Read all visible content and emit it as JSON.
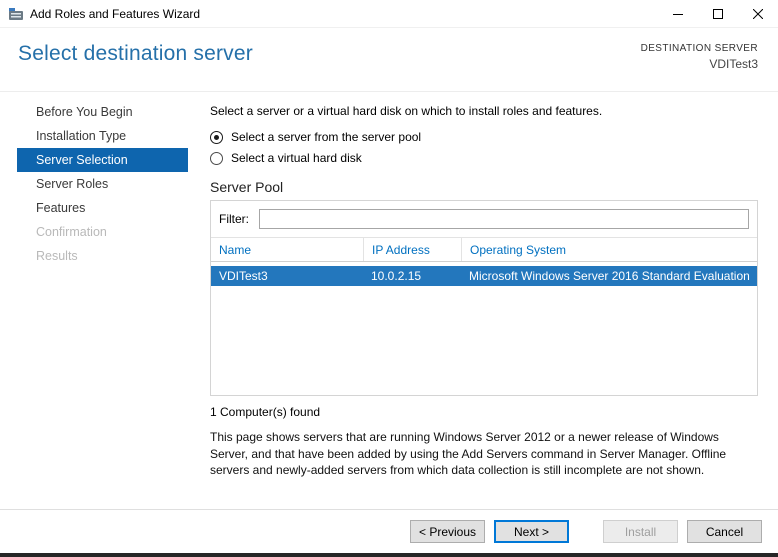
{
  "window": {
    "title": "Add Roles and Features Wizard",
    "icons": {
      "app": "server-manager-icon",
      "minimize": "minimize-icon",
      "maximize": "maximize-icon",
      "close": "close-icon"
    }
  },
  "header": {
    "title": "Select destination server",
    "destination_label": "DESTINATION SERVER",
    "destination_value": "VDITest3"
  },
  "sidebar": {
    "items": [
      {
        "label": "Before You Begin",
        "state": "enabled"
      },
      {
        "label": "Installation Type",
        "state": "enabled"
      },
      {
        "label": "Server Selection",
        "state": "selected"
      },
      {
        "label": "Server Roles",
        "state": "enabled"
      },
      {
        "label": "Features",
        "state": "enabled"
      },
      {
        "label": "Confirmation",
        "state": "disabled"
      },
      {
        "label": "Results",
        "state": "disabled"
      }
    ]
  },
  "content": {
    "intro": "Select a server or a virtual hard disk on which to install roles and features.",
    "radios": [
      {
        "label": "Select a server from the server pool",
        "checked": true
      },
      {
        "label": "Select a virtual hard disk",
        "checked": false
      }
    ],
    "server_pool": {
      "title": "Server Pool",
      "filter_label": "Filter:",
      "filter_value": "",
      "columns": [
        "Name",
        "IP Address",
        "Operating System"
      ],
      "rows": [
        {
          "name": "VDITest3",
          "ip": "10.0.2.15",
          "os": "Microsoft Windows Server 2016 Standard Evaluation",
          "selected": true
        }
      ],
      "count_text": "1 Computer(s) found"
    },
    "description": "This page shows servers that are running Windows Server 2012 or a newer release of Windows Server, and that have been added by using the Add Servers command in Server Manager. Offline servers and newly-added servers from which data collection is still incomplete are not shown."
  },
  "footer": {
    "buttons": [
      {
        "label": "< Previous",
        "state": "enabled"
      },
      {
        "label": "Next >",
        "state": "focused"
      },
      {
        "label": "Install",
        "state": "disabled"
      },
      {
        "label": "Cancel",
        "state": "enabled"
      }
    ]
  },
  "colors": {
    "accent_heading": "#2570a9",
    "nav_selected_bg": "#0e65ae",
    "row_selected_bg": "#2377bd",
    "grid_header_text": "#0070c0",
    "focus_border": "#0078d7"
  }
}
